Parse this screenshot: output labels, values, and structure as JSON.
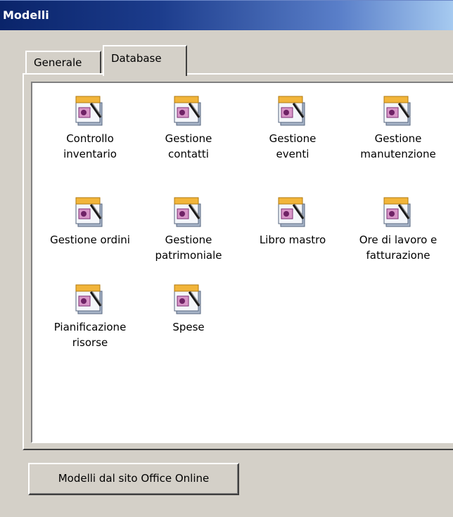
{
  "window": {
    "title": "Modelli"
  },
  "tabs": [
    {
      "label": "Generale",
      "selected": false
    },
    {
      "label": "Database",
      "selected": true
    }
  ],
  "templates": [
    {
      "label": "Controllo\ninventario",
      "icon": "access-template-icon"
    },
    {
      "label": "Gestione\ncontatti",
      "icon": "access-template-icon"
    },
    {
      "label": "Gestione\neventi",
      "icon": "access-template-icon"
    },
    {
      "label": "Gestione\nmanutenzione",
      "icon": "access-template-icon"
    },
    {
      "label": "Gestione ordini",
      "icon": "access-template-icon"
    },
    {
      "label": "Gestione\npatrimoniale",
      "icon": "access-template-icon"
    },
    {
      "label": "Libro mastro",
      "icon": "access-template-icon"
    },
    {
      "label": "Ore di lavoro e\nfatturazione",
      "icon": "access-template-icon"
    },
    {
      "label": "Pianificazione\nrisorse",
      "icon": "access-template-icon"
    },
    {
      "label": "Spese",
      "icon": "access-template-icon"
    }
  ],
  "buttons": {
    "office_online": "Modelli dal sito Office Online"
  }
}
